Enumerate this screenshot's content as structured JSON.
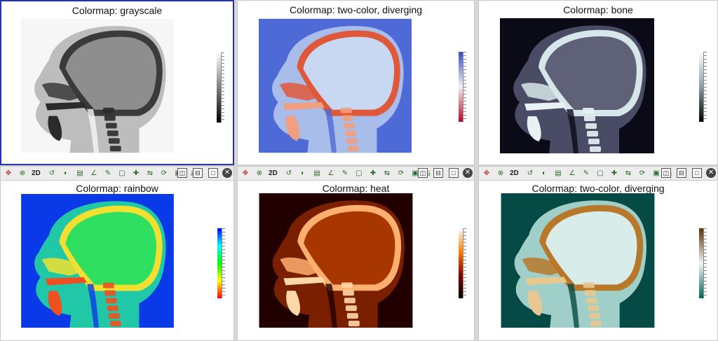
{
  "panels": [
    {
      "title": "Colormap: grayscale",
      "bg": "#f6f6f6",
      "skull": "#3a3a3a",
      "brain": "#8e8e8e",
      "tissue": "#bdbdbd",
      "bright": "#2b2b2b",
      "bar": [
        "#ffffff",
        "#000000"
      ]
    },
    {
      "title": "Colormap: two-color, diverging",
      "bg": "#4d6ad6",
      "skull": "#e0583a",
      "brain": "#c9d8f2",
      "tissue": "#a9bdeb",
      "bright": "#f0a080",
      "bar": [
        "#3b4cc0",
        "#f2f2f2",
        "#b40426"
      ]
    },
    {
      "title": "Colormap: bone",
      "bg": "#0b0b18",
      "skull": "#d7e7e9",
      "brain": "#5f6178",
      "tissue": "#4a4c66",
      "bright": "#e8f2f2",
      "bar": [
        "#ffffff",
        "#8aa0a6",
        "#000000"
      ]
    },
    {
      "title": "Colormap: rainbow",
      "bg": "#0a3ae8",
      "skull": "#f2e030",
      "brain": "#2fe060",
      "tissue": "#20c8a8",
      "bright": "#f05020",
      "bar": [
        "#0000ff",
        "#00ffff",
        "#00ff00",
        "#ffff00",
        "#ff0000"
      ]
    },
    {
      "title": "Colormap: heat",
      "bg": "#220000",
      "skull": "#ffb070",
      "brain": "#a83600",
      "tissue": "#7a2000",
      "bright": "#ffd8a8",
      "bar": [
        "#ffffff",
        "#ff8000",
        "#800000",
        "#000000"
      ]
    },
    {
      "title": "Colormap: two-color, diverging",
      "bg": "#054a44",
      "skull": "#b8782a",
      "brain": "#d8ecea",
      "tissue": "#9fcfc8",
      "bright": "#e8c890",
      "bar": [
        "#5a3004",
        "#f5f5f5",
        "#01665e"
      ]
    }
  ],
  "toolbar": {
    "mode_label": "2D",
    "icons": [
      "pan-icon",
      "zoom-icon",
      "reset-view-icon",
      "window-level-icon",
      "ruler-icon",
      "angle-icon",
      "probe-icon",
      "roi-icon",
      "crosshair-icon",
      "flip-icon",
      "rotate-icon",
      "snapshot-icon",
      "export-icon"
    ],
    "layout_buttons": [
      "split-vertical-icon",
      "split-horizontal-icon",
      "single-view-icon"
    ],
    "close_icon": "close-icon"
  }
}
